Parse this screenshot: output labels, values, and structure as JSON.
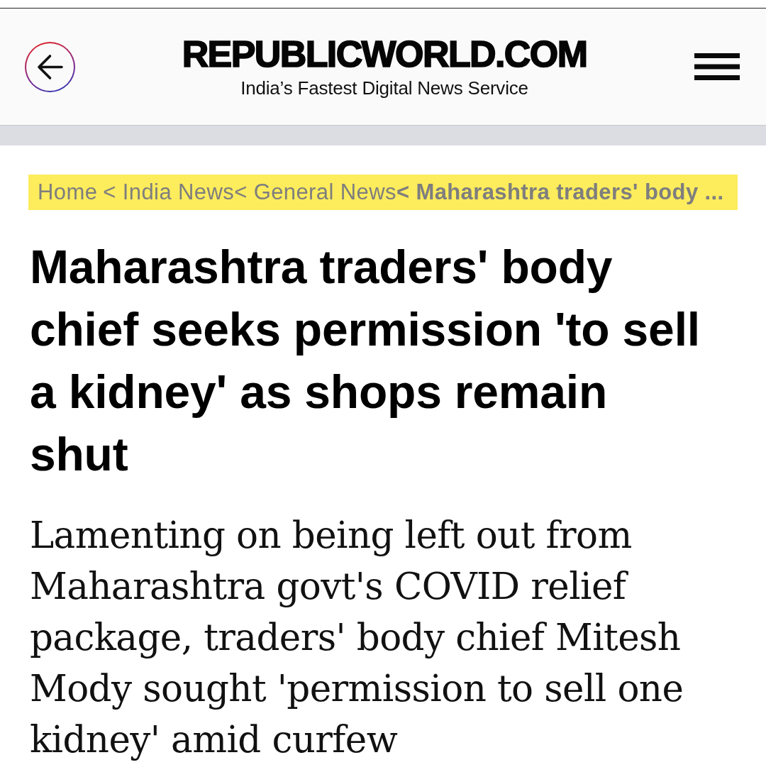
{
  "header": {
    "logo": "REPUBLICWORLD.COM",
    "tagline": "India’s Fastest Digital News Service"
  },
  "breadcrumb": [
    {
      "label": "Home",
      "current": false
    },
    {
      "label": "< India News",
      "current": false
    },
    {
      "label": "< General News",
      "current": false
    },
    {
      "label": "< Maharashtra traders' body ...",
      "current": true
    }
  ],
  "article": {
    "headline": "Maharashtra traders' body chief seeks permission 'to sell a kidney' as shops remain shut",
    "summary": "Lamenting on being left out from Maharashtra govt's COVID relief package, traders' body chief Mitesh Mody sought 'permission to sell one kidney' amid curfew"
  }
}
